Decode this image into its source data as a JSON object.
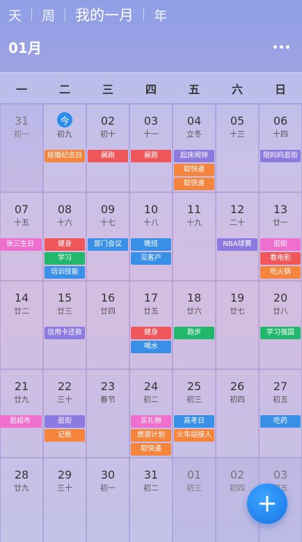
{
  "tabs": [
    {
      "label": "天"
    },
    {
      "label": "周"
    },
    {
      "label": "我的一月",
      "active": true
    },
    {
      "label": "年"
    }
  ],
  "month_label": "01月",
  "weekdays": [
    "一",
    "二",
    "三",
    "四",
    "五",
    "六",
    "日"
  ],
  "event_colors": {
    "orange": "#f5843d",
    "red": "#f0575b",
    "blue": "#3a8fe6",
    "purple": "#8d7ae0",
    "green": "#22b86b",
    "pink": "#ee6fcd"
  },
  "days": [
    {
      "day": "31",
      "lunar": "初一",
      "dim": true,
      "events": []
    },
    {
      "day": "今",
      "lunar": "初九",
      "today": true,
      "events": [
        {
          "text": "结婚纪念日",
          "color": "orange"
        }
      ]
    },
    {
      "day": "02",
      "lunar": "初十",
      "events": [
        {
          "text": "晨跑",
          "color": "red"
        }
      ]
    },
    {
      "day": "03",
      "lunar": "十一",
      "events": [
        {
          "text": "晨跑",
          "color": "red"
        }
      ]
    },
    {
      "day": "04",
      "lunar": "立冬",
      "events": [
        {
          "text": "起床闹钟",
          "color": "purple"
        },
        {
          "text": "取快递",
          "color": "orange"
        },
        {
          "text": "取快递",
          "color": "orange"
        }
      ]
    },
    {
      "day": "05",
      "lunar": "十三",
      "events": []
    },
    {
      "day": "06",
      "lunar": "十四",
      "events": [
        {
          "text": "陪妈妈逛街",
          "color": "purple"
        }
      ]
    },
    {
      "day": "07",
      "lunar": "十五",
      "events": [
        {
          "text": "张三生日",
          "color": "pink"
        }
      ]
    },
    {
      "day": "08",
      "lunar": "十六",
      "events": [
        {
          "text": "健身",
          "color": "red"
        },
        {
          "text": "学习",
          "color": "green"
        },
        {
          "text": "培训技能",
          "color": "blue"
        }
      ]
    },
    {
      "day": "09",
      "lunar": "十七",
      "events": [
        {
          "text": "部门会议",
          "color": "blue"
        }
      ]
    },
    {
      "day": "10",
      "lunar": "十八",
      "events": [
        {
          "text": "晚班",
          "color": "blue"
        },
        {
          "text": "见客户",
          "color": "blue"
        }
      ]
    },
    {
      "day": "11",
      "lunar": "十九",
      "events": []
    },
    {
      "day": "12",
      "lunar": "二十",
      "events": [
        {
          "text": "NBA球赛",
          "color": "purple"
        }
      ]
    },
    {
      "day": "13",
      "lunar": "廿一",
      "events": [
        {
          "text": "逛街",
          "color": "pink"
        },
        {
          "text": "看电影",
          "color": "red"
        },
        {
          "text": "吃火锅",
          "color": "orange"
        }
      ]
    },
    {
      "day": "14",
      "lunar": "廿二",
      "events": []
    },
    {
      "day": "15",
      "lunar": "廿三",
      "events": [
        {
          "text": "信用卡还款",
          "color": "purple"
        }
      ]
    },
    {
      "day": "16",
      "lunar": "廿四",
      "events": []
    },
    {
      "day": "17",
      "lunar": "廿五",
      "events": [
        {
          "text": "健身",
          "color": "red"
        },
        {
          "text": "喝水",
          "color": "blue"
        }
      ]
    },
    {
      "day": "18",
      "lunar": "廿六",
      "events": [
        {
          "text": "跑步",
          "color": "green"
        }
      ]
    },
    {
      "day": "19",
      "lunar": "廿七",
      "events": []
    },
    {
      "day": "20",
      "lunar": "廿八",
      "events": [
        {
          "text": "学习强国",
          "color": "green"
        }
      ]
    },
    {
      "day": "21",
      "lunar": "廿九",
      "events": [
        {
          "text": "逛超市",
          "color": "pink"
        }
      ]
    },
    {
      "day": "22",
      "lunar": "三十",
      "events": [
        {
          "text": "逛街",
          "color": "purple"
        },
        {
          "text": "记账",
          "color": "orange"
        }
      ]
    },
    {
      "day": "23",
      "lunar": "春节",
      "events": []
    },
    {
      "day": "24",
      "lunar": "初二",
      "events": [
        {
          "text": "买礼物",
          "color": "pink"
        },
        {
          "text": "旅游计划",
          "color": "orange"
        },
        {
          "text": "取快递",
          "color": "orange"
        }
      ]
    },
    {
      "day": "25",
      "lunar": "初三",
      "events": [
        {
          "text": "高考日",
          "color": "blue"
        },
        {
          "text": "火车站接人",
          "color": "orange"
        }
      ]
    },
    {
      "day": "26",
      "lunar": "初四",
      "events": []
    },
    {
      "day": "27",
      "lunar": "初五",
      "events": [
        {
          "text": "吃药",
          "color": "blue"
        }
      ]
    },
    {
      "day": "28",
      "lunar": "廿九",
      "events": []
    },
    {
      "day": "29",
      "lunar": "三十",
      "events": []
    },
    {
      "day": "30",
      "lunar": "初一",
      "events": []
    },
    {
      "day": "31",
      "lunar": "初二",
      "events": []
    },
    {
      "day": "01",
      "lunar": "初三",
      "dim": true,
      "events": []
    },
    {
      "day": "02",
      "lunar": "初四",
      "dim": true,
      "events": []
    },
    {
      "day": "03",
      "lunar": "初五",
      "dim": true,
      "events": []
    }
  ],
  "fab_icon": "plus-icon"
}
